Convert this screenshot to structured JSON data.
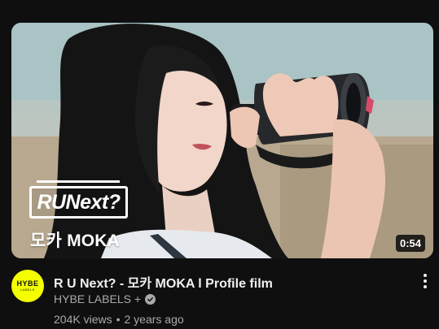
{
  "video": {
    "thumbnail": {
      "logo_text": "RUNext?",
      "name_caption": "모카 MOKA",
      "duration": "0:54"
    },
    "title": "R U Next? - 모카 MOKA l Profile film",
    "channel": {
      "avatar_text": "HYBE",
      "avatar_subtext": "LABELS",
      "name": "HYBE LABELS +",
      "verified_icon": "check-circle-icon"
    },
    "views": "204K views",
    "separator": "•",
    "age": "2 years ago",
    "menu_icon": "more-vert-icon"
  },
  "colors": {
    "background": "#0f0f0f",
    "avatar": "#f3ff00",
    "text_primary": "#f1f1f1",
    "text_secondary": "#aaaaaa"
  }
}
